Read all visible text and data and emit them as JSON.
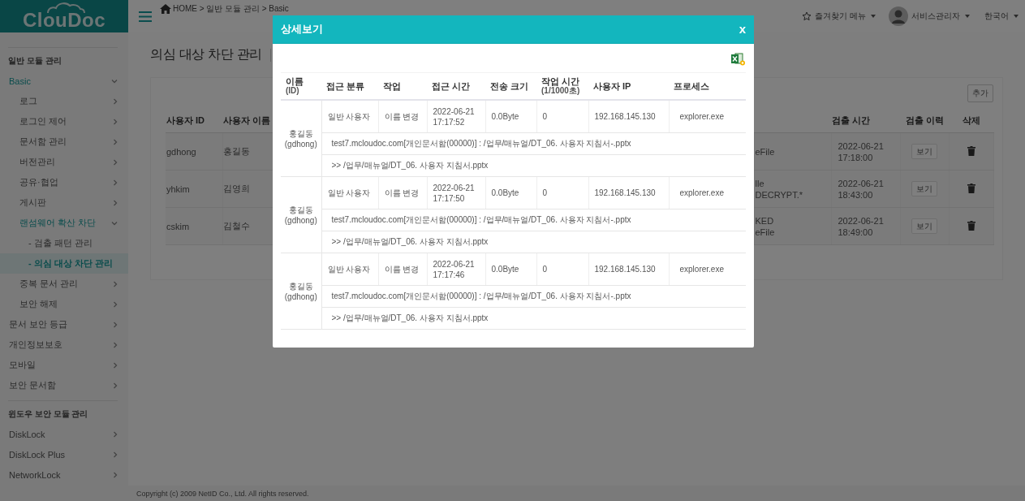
{
  "logo": {
    "text": "ClouDoc"
  },
  "topbar": {
    "breadcrumb": "HOME > 일반 모듈 관리 > Basic",
    "favorites": "즐겨찾기 메뉴",
    "user": "서비스관리자",
    "language": "한국어"
  },
  "sidebar": {
    "sections": [
      {
        "title": "일반 모듈 관리",
        "items": [
          {
            "label": "Basic",
            "selected": false,
            "expanded": true,
            "children": [
              {
                "label": "로그",
                "selected": false,
                "expanded": false
              },
              {
                "label": "로그인 제어",
                "selected": false,
                "expanded": false
              },
              {
                "label": "문서함 관리",
                "selected": false,
                "expanded": false
              },
              {
                "label": "버전관리",
                "selected": false,
                "expanded": false
              },
              {
                "label": "공유·협업",
                "selected": false,
                "expanded": false
              },
              {
                "label": "게시판",
                "selected": false,
                "expanded": false
              },
              {
                "label": "랜섬웨어 확산 차단",
                "selected": false,
                "expanded": true,
                "children": [
                  {
                    "label": "- 검출 패턴 관리",
                    "selected": false
                  },
                  {
                    "label": "- 의심 대상 차단 관리",
                    "selected": true
                  }
                ]
              },
              {
                "label": "중복 문서 관리",
                "selected": false,
                "expanded": false
              },
              {
                "label": "보안 해제",
                "selected": false,
                "expanded": false
              }
            ]
          },
          {
            "label": "문서 보안 등급",
            "selected": false,
            "expanded": false
          },
          {
            "label": "개인정보보호",
            "selected": false,
            "expanded": false
          },
          {
            "label": "모바일",
            "selected": false,
            "expanded": false
          },
          {
            "label": "보안 문서함",
            "selected": false,
            "expanded": false
          }
        ]
      },
      {
        "title": "윈도우 보안 모듈 관리",
        "items": [
          {
            "label": "DiskLock",
            "selected": false,
            "expanded": false
          },
          {
            "label": "DiskLock Plus",
            "selected": false,
            "expanded": false
          },
          {
            "label": "NetworkLock",
            "selected": false,
            "expanded": false
          }
        ]
      }
    ]
  },
  "page": {
    "title": "의심 대상 차단 관리",
    "add_button": "추가",
    "table": {
      "columns": [
        "사용자 ID",
        "사용자 이름",
        "",
        "검출 시간",
        "검출 이력",
        "삭제"
      ],
      "rows": [
        {
          "user_id": "gdhong",
          "user_name": "홍길동",
          "column_3": [
            "eFile"
          ],
          "date": "2022-06-21",
          "time": "17:18:00",
          "history": "보기"
        },
        {
          "user_id": "yhkim",
          "user_name": "김영희",
          "column_3": [
            "lle",
            "DECRYPT.*"
          ],
          "date": "2022-06-21",
          "time": "18:43:00",
          "history": "보기"
        },
        {
          "user_id": "cskim",
          "user_name": "김철수",
          "column_3": [
            "KED",
            "eFile"
          ],
          "date": "2022-06-21",
          "time": "18:49:00",
          "history": "보기"
        }
      ]
    }
  },
  "modal": {
    "title": "상세보기",
    "close": "x",
    "columns": [
      {
        "label": "이름",
        "sub": "(ID)"
      },
      {
        "label": "접근 분류"
      },
      {
        "label": "작업"
      },
      {
        "label": "접근 시간"
      },
      {
        "label": "전송 크기"
      },
      {
        "label": "작업 시간",
        "sub": "(1/1000초)"
      },
      {
        "label": "사용자 IP"
      },
      {
        "label": "프로세스"
      }
    ],
    "records": [
      {
        "name": "홍길동",
        "id": "(gdhong)",
        "access_type": "일반 사용자",
        "action": "이름 변경",
        "date": "2022-06-21",
        "time": "17:17:52",
        "size": "0.0Byte",
        "duration": "0",
        "ip": "192.168.145.130",
        "process": "explorer.exe",
        "source": "test7.mcloudoc.com[개인문서함(00000)] : /업무/매뉴얼/DT_06. 사용자 지침서-.pptx",
        "target": ">> /업무/매뉴얼/DT_06. 사용자 지침서.pptx"
      },
      {
        "name": "홍길동",
        "id": "(gdhong)",
        "access_type": "일반 사용자",
        "action": "이름 변경",
        "date": "2022-06-21",
        "time": "17:17:50",
        "size": "0.0Byte",
        "duration": "0",
        "ip": "192.168.145.130",
        "process": "explorer.exe",
        "source": "test7.mcloudoc.com[개인문서함(00000)] : /업무/매뉴얼/DT_06. 사용자 지침서-.pptx",
        "target": ">> /업무/매뉴얼/DT_06. 사용자 지침서.pptx"
      },
      {
        "name": "홍길동",
        "id": "(gdhong)",
        "access_type": "일반 사용자",
        "action": "이름 변경",
        "date": "2022-06-21",
        "time": "17:17:46",
        "size": "0.0Byte",
        "duration": "0",
        "ip": "192.168.145.130",
        "process": "explorer.exe",
        "source": "test7.mcloudoc.com[개인문서함(00000)] : /업무/매뉴얼/DT_06. 사용자 지침서-.pptx",
        "target": ">> /업무/매뉴얼/DT_06. 사용자 지침서.pptx"
      }
    ]
  },
  "footer": "Copyright (c) 2009 NetID Co., Ltd. All rights reserved."
}
